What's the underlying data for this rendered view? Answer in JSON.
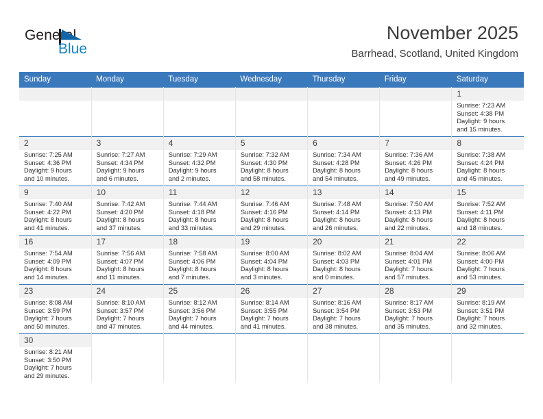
{
  "brand": {
    "name_part1": "General",
    "name_part2": "Blue",
    "flag_icon": "triangle-flag-icon",
    "color_primary": "#1583c8",
    "color_text": "#231f20"
  },
  "header": {
    "title": "November 2025",
    "subtitle": "Barrhead, Scotland, United Kingdom"
  },
  "theme": {
    "header_blue": "#3b79bd",
    "daynum_band": "#f1f1f1",
    "grid_line": "#e4e4e4",
    "row_rule": "#3b79bd"
  },
  "weekdays": [
    "Sunday",
    "Monday",
    "Tuesday",
    "Wednesday",
    "Thursday",
    "Friday",
    "Saturday"
  ],
  "weeks": [
    [
      {
        "day": "",
        "blank": true
      },
      {
        "day": "",
        "blank": true
      },
      {
        "day": "",
        "blank": true
      },
      {
        "day": "",
        "blank": true
      },
      {
        "day": "",
        "blank": true
      },
      {
        "day": "",
        "blank": true
      },
      {
        "day": "1",
        "sunrise": "Sunrise: 7:23 AM",
        "sunset": "Sunset: 4:38 PM",
        "daylight1": "Daylight: 9 hours",
        "daylight2": "and 15 minutes."
      }
    ],
    [
      {
        "day": "2",
        "sunrise": "Sunrise: 7:25 AM",
        "sunset": "Sunset: 4:36 PM",
        "daylight1": "Daylight: 9 hours",
        "daylight2": "and 10 minutes."
      },
      {
        "day": "3",
        "sunrise": "Sunrise: 7:27 AM",
        "sunset": "Sunset: 4:34 PM",
        "daylight1": "Daylight: 9 hours",
        "daylight2": "and 6 minutes."
      },
      {
        "day": "4",
        "sunrise": "Sunrise: 7:29 AM",
        "sunset": "Sunset: 4:32 PM",
        "daylight1": "Daylight: 9 hours",
        "daylight2": "and 2 minutes."
      },
      {
        "day": "5",
        "sunrise": "Sunrise: 7:32 AM",
        "sunset": "Sunset: 4:30 PM",
        "daylight1": "Daylight: 8 hours",
        "daylight2": "and 58 minutes."
      },
      {
        "day": "6",
        "sunrise": "Sunrise: 7:34 AM",
        "sunset": "Sunset: 4:28 PM",
        "daylight1": "Daylight: 8 hours",
        "daylight2": "and 54 minutes."
      },
      {
        "day": "7",
        "sunrise": "Sunrise: 7:36 AM",
        "sunset": "Sunset: 4:26 PM",
        "daylight1": "Daylight: 8 hours",
        "daylight2": "and 49 minutes."
      },
      {
        "day": "8",
        "sunrise": "Sunrise: 7:38 AM",
        "sunset": "Sunset: 4:24 PM",
        "daylight1": "Daylight: 8 hours",
        "daylight2": "and 45 minutes."
      }
    ],
    [
      {
        "day": "9",
        "sunrise": "Sunrise: 7:40 AM",
        "sunset": "Sunset: 4:22 PM",
        "daylight1": "Daylight: 8 hours",
        "daylight2": "and 41 minutes."
      },
      {
        "day": "10",
        "sunrise": "Sunrise: 7:42 AM",
        "sunset": "Sunset: 4:20 PM",
        "daylight1": "Daylight: 8 hours",
        "daylight2": "and 37 minutes."
      },
      {
        "day": "11",
        "sunrise": "Sunrise: 7:44 AM",
        "sunset": "Sunset: 4:18 PM",
        "daylight1": "Daylight: 8 hours",
        "daylight2": "and 33 minutes."
      },
      {
        "day": "12",
        "sunrise": "Sunrise: 7:46 AM",
        "sunset": "Sunset: 4:16 PM",
        "daylight1": "Daylight: 8 hours",
        "daylight2": "and 29 minutes."
      },
      {
        "day": "13",
        "sunrise": "Sunrise: 7:48 AM",
        "sunset": "Sunset: 4:14 PM",
        "daylight1": "Daylight: 8 hours",
        "daylight2": "and 26 minutes."
      },
      {
        "day": "14",
        "sunrise": "Sunrise: 7:50 AM",
        "sunset": "Sunset: 4:13 PM",
        "daylight1": "Daylight: 8 hours",
        "daylight2": "and 22 minutes."
      },
      {
        "day": "15",
        "sunrise": "Sunrise: 7:52 AM",
        "sunset": "Sunset: 4:11 PM",
        "daylight1": "Daylight: 8 hours",
        "daylight2": "and 18 minutes."
      }
    ],
    [
      {
        "day": "16",
        "sunrise": "Sunrise: 7:54 AM",
        "sunset": "Sunset: 4:09 PM",
        "daylight1": "Daylight: 8 hours",
        "daylight2": "and 14 minutes."
      },
      {
        "day": "17",
        "sunrise": "Sunrise: 7:56 AM",
        "sunset": "Sunset: 4:07 PM",
        "daylight1": "Daylight: 8 hours",
        "daylight2": "and 11 minutes."
      },
      {
        "day": "18",
        "sunrise": "Sunrise: 7:58 AM",
        "sunset": "Sunset: 4:06 PM",
        "daylight1": "Daylight: 8 hours",
        "daylight2": "and 7 minutes."
      },
      {
        "day": "19",
        "sunrise": "Sunrise: 8:00 AM",
        "sunset": "Sunset: 4:04 PM",
        "daylight1": "Daylight: 8 hours",
        "daylight2": "and 3 minutes."
      },
      {
        "day": "20",
        "sunrise": "Sunrise: 8:02 AM",
        "sunset": "Sunset: 4:03 PM",
        "daylight1": "Daylight: 8 hours",
        "daylight2": "and 0 minutes."
      },
      {
        "day": "21",
        "sunrise": "Sunrise: 8:04 AM",
        "sunset": "Sunset: 4:01 PM",
        "daylight1": "Daylight: 7 hours",
        "daylight2": "and 57 minutes."
      },
      {
        "day": "22",
        "sunrise": "Sunrise: 8:06 AM",
        "sunset": "Sunset: 4:00 PM",
        "daylight1": "Daylight: 7 hours",
        "daylight2": "and 53 minutes."
      }
    ],
    [
      {
        "day": "23",
        "sunrise": "Sunrise: 8:08 AM",
        "sunset": "Sunset: 3:59 PM",
        "daylight1": "Daylight: 7 hours",
        "daylight2": "and 50 minutes."
      },
      {
        "day": "24",
        "sunrise": "Sunrise: 8:10 AM",
        "sunset": "Sunset: 3:57 PM",
        "daylight1": "Daylight: 7 hours",
        "daylight2": "and 47 minutes."
      },
      {
        "day": "25",
        "sunrise": "Sunrise: 8:12 AM",
        "sunset": "Sunset: 3:56 PM",
        "daylight1": "Daylight: 7 hours",
        "daylight2": "and 44 minutes."
      },
      {
        "day": "26",
        "sunrise": "Sunrise: 8:14 AM",
        "sunset": "Sunset: 3:55 PM",
        "daylight1": "Daylight: 7 hours",
        "daylight2": "and 41 minutes."
      },
      {
        "day": "27",
        "sunrise": "Sunrise: 8:16 AM",
        "sunset": "Sunset: 3:54 PM",
        "daylight1": "Daylight: 7 hours",
        "daylight2": "and 38 minutes."
      },
      {
        "day": "28",
        "sunrise": "Sunrise: 8:17 AM",
        "sunset": "Sunset: 3:53 PM",
        "daylight1": "Daylight: 7 hours",
        "daylight2": "and 35 minutes."
      },
      {
        "day": "29",
        "sunrise": "Sunrise: 8:19 AM",
        "sunset": "Sunset: 3:51 PM",
        "daylight1": "Daylight: 7 hours",
        "daylight2": "and 32 minutes."
      }
    ],
    [
      {
        "day": "30",
        "sunrise": "Sunrise: 8:21 AM",
        "sunset": "Sunset: 3:50 PM",
        "daylight1": "Daylight: 7 hours",
        "daylight2": "and 29 minutes."
      },
      {
        "day": "",
        "off": true
      },
      {
        "day": "",
        "off": true
      },
      {
        "day": "",
        "off": true
      },
      {
        "day": "",
        "off": true
      },
      {
        "day": "",
        "off": true
      },
      {
        "day": "",
        "off": true
      }
    ]
  ]
}
